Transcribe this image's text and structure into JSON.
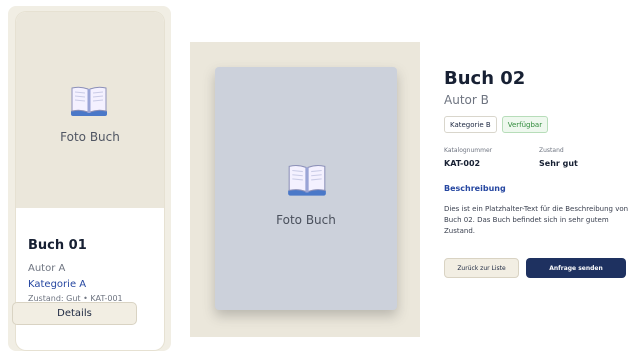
{
  "card": {
    "photo_label": "Foto Buch",
    "title": "Buch 01",
    "author": "Autor A",
    "category": "Kategorie A",
    "meta": "Zustand: Gut • KAT-001",
    "details_label": "Details",
    "icon": "book-icon"
  },
  "detail": {
    "photo_label": "Foto Buch",
    "icon": "book-icon",
    "title": "Buch 02",
    "author": "Autor B",
    "badges": {
      "category": "Kategorie B",
      "availability": "Verfügbar"
    },
    "fields": {
      "catalog_label": "Katalognummer",
      "catalog_value": "KAT-002",
      "condition_label": "Zustand",
      "condition_value": "Sehr gut"
    },
    "description_heading": "Beschreibung",
    "description_text": "Dies ist ein Platzhalter-Text für die Beschreibung von Buch 02. Das Buch befindet sich in sehr gutem Zustand.",
    "back_label": "Zurück zur Liste",
    "send_label": "Anfrage senden"
  },
  "colors": {
    "accent": "#2647a1",
    "primary_button": "#1e3160",
    "available_green": "#2f8a3a",
    "photo_placeholder": "#ccd1db",
    "beige_panel": "#ebe7db"
  }
}
